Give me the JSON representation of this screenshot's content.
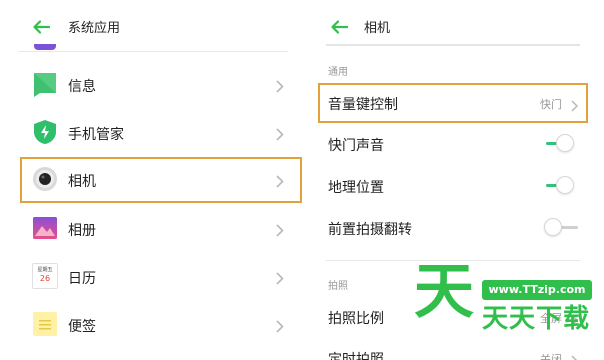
{
  "colors": {
    "accent": "#2fbf4a",
    "highlight": "#e3a13a",
    "toggle_on": "#31c37a"
  },
  "left_panel": {
    "title": "系统应用",
    "apps": [
      {
        "label": "信息",
        "icon": "messages-icon"
      },
      {
        "label": "手机管家",
        "icon": "phone-manager-icon"
      },
      {
        "label": "相机",
        "icon": "camera-icon"
      },
      {
        "label": "相册",
        "icon": "gallery-icon"
      },
      {
        "label": "日历",
        "icon": "calendar-icon",
        "icon_top_text": "星期五",
        "icon_date": "26"
      },
      {
        "label": "便签",
        "icon": "notes-icon"
      }
    ]
  },
  "right_panel": {
    "title": "相机",
    "section_general": "通用",
    "settings": [
      {
        "label": "音量键控制",
        "value": "快门"
      },
      {
        "label": "快门声音",
        "toggle": true
      },
      {
        "label": "地理位置",
        "toggle": true
      },
      {
        "label": "前置拍摄翻转",
        "toggle": false
      }
    ],
    "section_photo": "拍照",
    "photo_settings": [
      {
        "label": "拍照比例",
        "value": "全屏"
      },
      {
        "label": "定时拍照",
        "value": "关闭"
      }
    ]
  },
  "watermark": {
    "big_char": "天",
    "url": "www.TTzip.com",
    "name": "天天下载"
  }
}
